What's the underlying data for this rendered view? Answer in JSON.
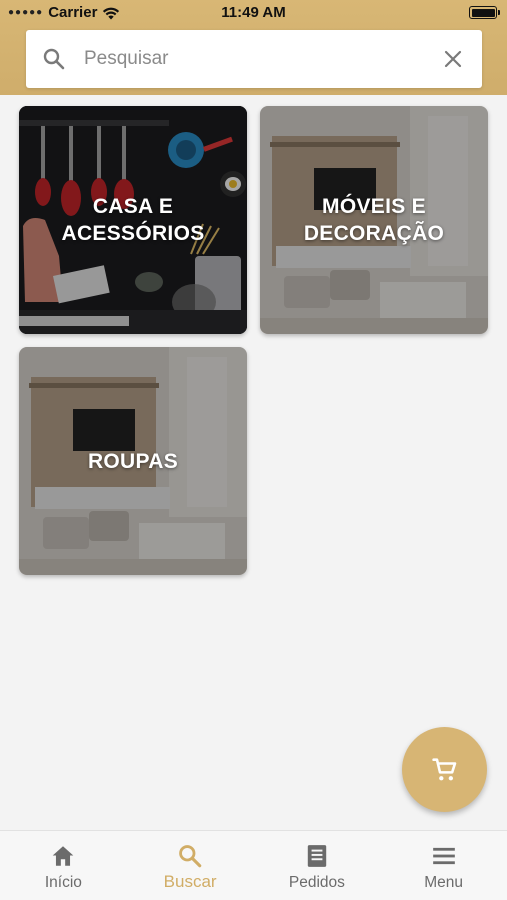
{
  "status_bar": {
    "carrier": "Carrier",
    "time": "11:49 AM"
  },
  "search": {
    "placeholder": "Pesquisar",
    "value": ""
  },
  "categories": [
    {
      "label": "CASA E\nACESSÓRIOS",
      "image": "kitchen-utensils"
    },
    {
      "label": "MÓVEIS E\nDECORAÇÃO",
      "image": "living-room"
    },
    {
      "label": "ROUPAS",
      "image": "living-room"
    }
  ],
  "fab": {
    "icon": "cart-icon"
  },
  "bottom_nav": {
    "items": [
      {
        "label": "Início",
        "icon": "home-icon",
        "active": false
      },
      {
        "label": "Buscar",
        "icon": "search-icon",
        "active": true
      },
      {
        "label": "Pedidos",
        "icon": "orders-icon",
        "active": false
      },
      {
        "label": "Menu",
        "icon": "menu-icon",
        "active": false
      }
    ]
  },
  "colors": {
    "brand": "#d7b574",
    "active_nav": "#d1ad66",
    "inactive_nav": "#6b6b6b",
    "background": "#f3f3f3"
  }
}
